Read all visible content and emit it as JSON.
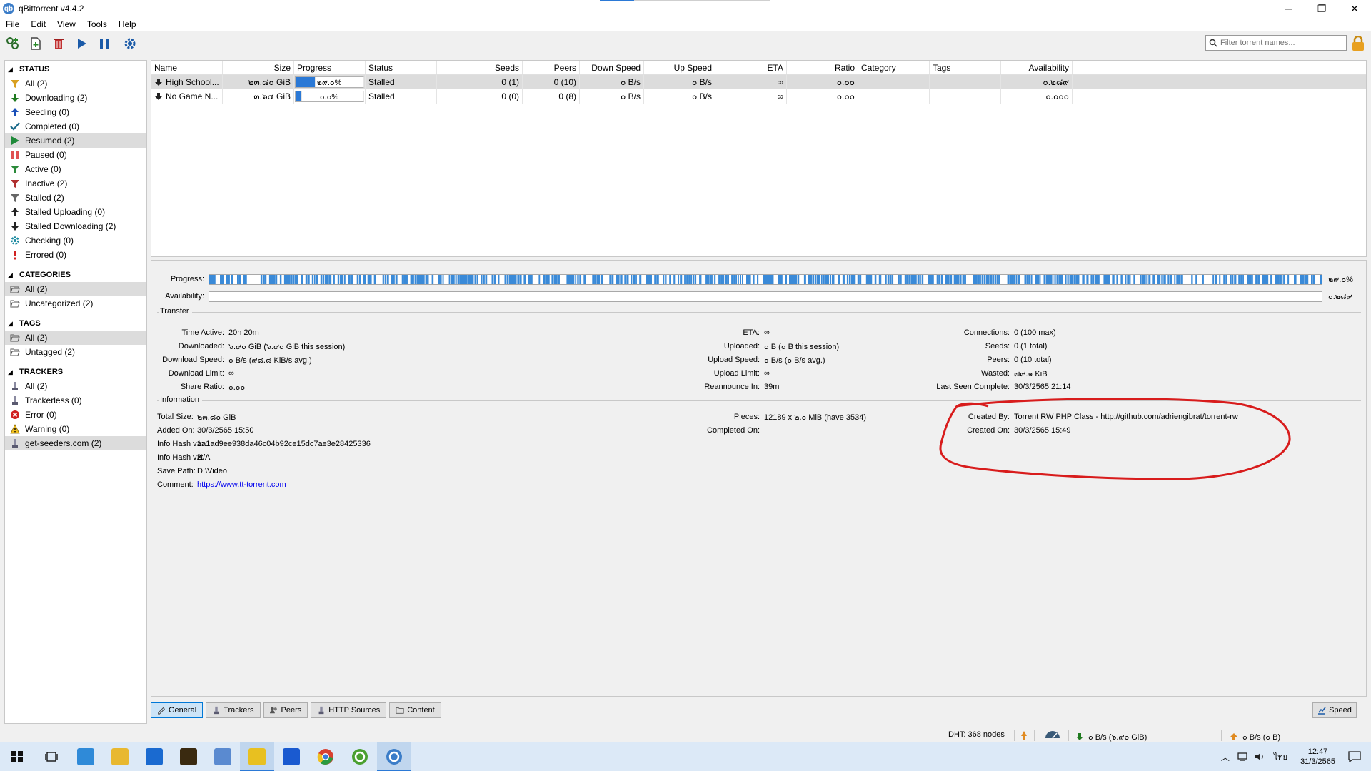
{
  "window": {
    "title": "qBittorrent v4.4.2",
    "app_icon_letters": "qb"
  },
  "window_controls": {
    "minimize": "─",
    "restore": "❐",
    "close": "✕"
  },
  "menu": [
    "File",
    "Edit",
    "View",
    "Tools",
    "Help"
  ],
  "toolbar": {
    "buttons": [
      "add-torrent-link-icon",
      "add-torrent-file-icon",
      "delete-icon",
      "resume-icon",
      "pause-icon",
      "options-gear-icon"
    ],
    "filter_placeholder": "Filter torrent names..."
  },
  "sidebar": {
    "status": {
      "title": "STATUS",
      "items": [
        {
          "label": "All (2)",
          "icon": "funnel-icon",
          "color": "#d9a020"
        },
        {
          "label": "Downloading (2)",
          "icon": "arrow-down-icon",
          "color": "#1f7a1f"
        },
        {
          "label": "Seeding (0)",
          "icon": "arrow-up-icon",
          "color": "#1a4fb8"
        },
        {
          "label": "Completed (0)",
          "icon": "check-icon",
          "color": "#1a6a8a"
        },
        {
          "label": "Resumed (2)",
          "icon": "play-icon",
          "color": "#1f8a3a",
          "selected": true
        },
        {
          "label": "Paused (0)",
          "icon": "pause-icon",
          "color": "#e05050"
        },
        {
          "label": "Active (0)",
          "icon": "funnel-icon",
          "color": "#2a8a3a"
        },
        {
          "label": "Inactive (2)",
          "icon": "funnel-icon",
          "color": "#b03030"
        },
        {
          "label": "Stalled (2)",
          "icon": "funnel-icon",
          "color": "#666666"
        },
        {
          "label": "Stalled Uploading (0)",
          "icon": "arrow-up-icon",
          "color": "#222222"
        },
        {
          "label": "Stalled Downloading (2)",
          "icon": "arrow-down-icon",
          "color": "#222222"
        },
        {
          "label": "Checking (0)",
          "icon": "gear-icon",
          "color": "#1a8aa0"
        },
        {
          "label": "Errored (0)",
          "icon": "exclamation-icon",
          "color": "#d02020"
        }
      ]
    },
    "categories": {
      "title": "CATEGORIES",
      "items": [
        {
          "label": "All (2)",
          "icon": "folder-open-icon",
          "selected": true
        },
        {
          "label": "Uncategorized (2)",
          "icon": "folder-open-icon"
        }
      ]
    },
    "tags": {
      "title": "TAGS",
      "items": [
        {
          "label": "All (2)",
          "icon": "folder-open-icon",
          "selected": true
        },
        {
          "label": "Untagged (2)",
          "icon": "folder-open-icon"
        }
      ]
    },
    "trackers": {
      "title": "TRACKERS",
      "items": [
        {
          "label": "All (2)",
          "icon": "tracker-icon"
        },
        {
          "label": "Trackerless (0)",
          "icon": "tracker-icon"
        },
        {
          "label": "Error (0)",
          "icon": "error-icon"
        },
        {
          "label": "Warning (0)",
          "icon": "warning-icon"
        },
        {
          "label": "get-seeders.com (2)",
          "icon": "tracker-icon",
          "selected": true
        }
      ]
    }
  },
  "torrent_list": {
    "columns": [
      "Name",
      "Size",
      "Progress",
      "Status",
      "Seeds",
      "Peers",
      "Down Speed",
      "Up Speed",
      "ETA",
      "Ratio",
      "Category",
      "Tags",
      "Availability"
    ],
    "rows": [
      {
        "name": "High School...",
        "size": "๒๓.๘๐ GiB",
        "progress_text": "๒๙.๐%",
        "progress": 0.29,
        "status": "Stalled",
        "seeds": "0 (1)",
        "peers": "0 (10)",
        "down": "๐ B/s",
        "up": "๐ B/s",
        "eta": "∞",
        "ratio": "๐.๐๐",
        "category": "",
        "tags": "",
        "availability": "๐.๒๘๙",
        "selected": true
      },
      {
        "name": "No Game N...",
        "size": "๓.๖๔ GiB",
        "progress_text": "๐.๐%",
        "progress": 0.0,
        "status": "Stalled",
        "seeds": "0 (0)",
        "peers": "0 (8)",
        "down": "๐ B/s",
        "up": "๐ B/s",
        "eta": "∞",
        "ratio": "๐.๐๐",
        "category": "",
        "tags": "",
        "availability": "๐.๐๐๐"
      }
    ]
  },
  "details": {
    "progress_label": "Progress:",
    "progress_value": "๒๙.๐%",
    "progress_fraction": 0.29,
    "availability_label": "Availability:",
    "availability_value": "๐.๒๘๙",
    "transfer": {
      "title": "Transfer",
      "col1": [
        {
          "k": "Time Active:",
          "v": "20h 20m"
        },
        {
          "k": "Downloaded:",
          "v": "๖.๙๐ GiB (๖.๙๐ GiB this session)"
        },
        {
          "k": "Download Speed:",
          "v": "๐ B/s (๙๘.๘ KiB/s avg.)"
        },
        {
          "k": "Download Limit:",
          "v": "∞"
        },
        {
          "k": "Share Ratio:",
          "v": "๐.๐๐"
        }
      ],
      "col2": [
        {
          "k": "ETA:",
          "v": "∞"
        },
        {
          "k": "Uploaded:",
          "v": "๐ B (๐ B this session)"
        },
        {
          "k": "Upload Speed:",
          "v": "๐ B/s (๐ B/s avg.)"
        },
        {
          "k": "Upload Limit:",
          "v": "∞"
        },
        {
          "k": "Reannounce In:",
          "v": "39m"
        }
      ],
      "col3": [
        {
          "k": "Connections:",
          "v": "0 (100 max)"
        },
        {
          "k": "Seeds:",
          "v": "0 (1 total)"
        },
        {
          "k": "Peers:",
          "v": "0 (10 total)"
        },
        {
          "k": "Wasted:",
          "v": "๗๙.๑ KiB"
        },
        {
          "k": "Last Seen Complete:",
          "v": "30/3/2565 21:14"
        }
      ]
    },
    "information": {
      "title": "Information",
      "col1": [
        {
          "k": "Total Size:",
          "v": "๒๓.๘๐ GiB"
        },
        {
          "k": "Added On:",
          "v": "30/3/2565 15:50"
        },
        {
          "k": "Info Hash v1:",
          "v": "aa1ad9ee938da46c04b92ce15dc7ae3e28425336"
        },
        {
          "k": "Info Hash v2:",
          "v": "N/A"
        },
        {
          "k": "Save Path:",
          "v": "D:\\Video"
        },
        {
          "k": "Comment:",
          "v": "https://www.tt-torrent.com",
          "link": true
        }
      ],
      "col2": [
        {
          "k": "Pieces:",
          "v": "12189 x ๒.๐ MiB (have 3534)"
        },
        {
          "k": "Completed On:",
          "v": ""
        }
      ],
      "col3": [
        {
          "k": "Created By:",
          "v": "Torrent RW PHP Class - http://github.com/adriengibrat/torrent-rw"
        },
        {
          "k": "Created On:",
          "v": "30/3/2565 15:49"
        }
      ]
    }
  },
  "tabs": [
    {
      "label": "General",
      "icon": "info-icon",
      "selected": true
    },
    {
      "label": "Trackers",
      "icon": "tracker-icon"
    },
    {
      "label": "Peers",
      "icon": "peers-icon"
    },
    {
      "label": "HTTP Sources",
      "icon": "http-icon"
    },
    {
      "label": "Content",
      "icon": "folder-icon"
    }
  ],
  "speed_button": "Speed",
  "statusbar": {
    "dht": "DHT: 368 nodes",
    "download": "๐ B/s (๖.๙๐ GiB)",
    "upload": "๐ B/s (๐ B)"
  },
  "taskbar": {
    "apps": [
      {
        "name": "start-icon",
        "color": "#1a1a1a"
      },
      {
        "name": "task-view-icon",
        "color": "#1a1a1a"
      },
      {
        "name": "app-window-icon",
        "color": "#2f8ad8"
      },
      {
        "name": "file-explorer-icon",
        "color": "#e8b830"
      },
      {
        "name": "store-icon",
        "color": "#1a6ad0"
      },
      {
        "name": "terminal-app-icon",
        "color": "#3a2a10"
      },
      {
        "name": "network-app-icon",
        "color": "#5a8ad0"
      },
      {
        "name": "keepass-icon",
        "color": "#e8c020",
        "active": true
      },
      {
        "name": "vpn-app-icon",
        "color": "#1a5ad0"
      },
      {
        "name": "chrome-icon",
        "color": "#d84030"
      },
      {
        "name": "utorrent-icon",
        "color": "#4aa030"
      },
      {
        "name": "qbittorrent-icon",
        "color": "#3b7dc8",
        "active": true
      }
    ],
    "lang": "ไทย",
    "time": "12:47",
    "date": "31/3/2565"
  }
}
